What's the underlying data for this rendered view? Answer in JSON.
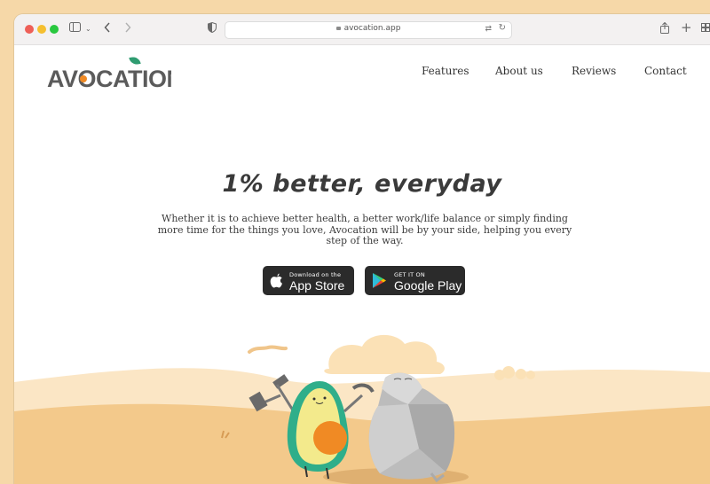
{
  "browser": {
    "url": "avocation.app",
    "icons": [
      "sidebar-icon",
      "chevron-down-icon",
      "back-icon",
      "forward-icon",
      "shield-icon",
      "translate-icon",
      "reload-icon",
      "share-icon",
      "new-tab-icon",
      "tab-overview-icon"
    ]
  },
  "site": {
    "logo": "AVOCATION",
    "nav": [
      "Features",
      "About us",
      "Reviews",
      "Contact"
    ]
  },
  "hero": {
    "headline": "1% better, everyday",
    "subtext": "Whether it is to achieve better health, a better work/life balance or simply finding more time for the things you love, Avocation will be by your side, helping you every step of the way."
  },
  "badges": {
    "appstore_small": "Download on the",
    "appstore_big": "App Store",
    "googleplay_small": "GET IT ON",
    "googleplay_big": "Google Play"
  },
  "colors": {
    "background": "#f6d8a8",
    "sand": "#f3c98b",
    "accent_orange": "#f08a24",
    "accent_green": "#2f9c71",
    "logo_gray": "#5b5b5b"
  }
}
